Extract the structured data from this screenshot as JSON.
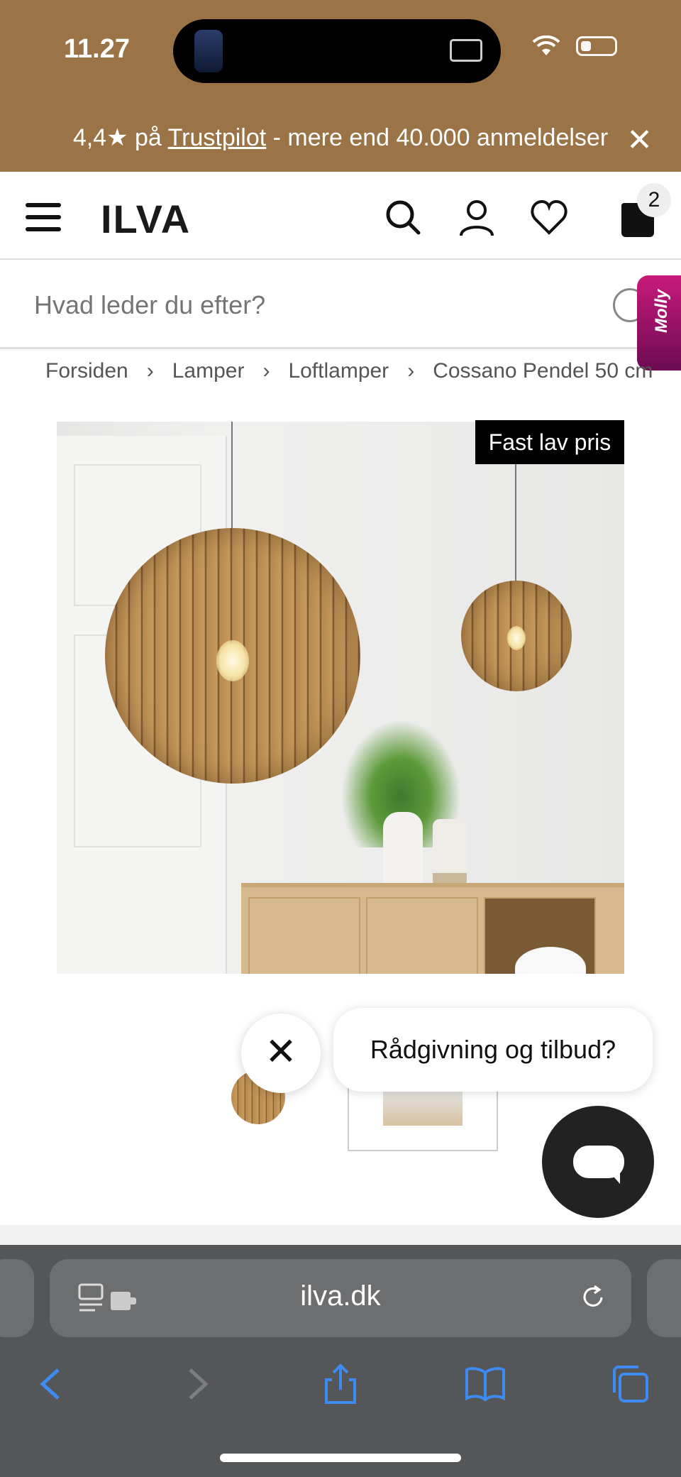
{
  "status_bar": {
    "time": "11.27"
  },
  "trust_banner": {
    "prefix": "4,4★ på ",
    "link": "Trustpilot",
    "suffix": " - mere end 40.000 anmeldelser",
    "close_glyph": "✕"
  },
  "header": {
    "logo": "ILVA",
    "cart_count": "2",
    "icons": [
      "menu-icon",
      "search-icon",
      "account-icon",
      "heart-icon",
      "bag-icon"
    ]
  },
  "search": {
    "placeholder": "Hvad leder du efter?"
  },
  "molly": {
    "label": "Molly"
  },
  "breadcrumb": {
    "items": [
      "Forsiden",
      "Lamper",
      "Loftlamper",
      "Cossano Pendel 50 cm"
    ],
    "separator": "›"
  },
  "product": {
    "badge": "Fast lav pris"
  },
  "chat": {
    "prompt": "Rådgivning og tilbud?",
    "close_glyph": "✕"
  },
  "browser": {
    "url": "ilva.dk"
  },
  "colors": {
    "banner": "#9a7446",
    "molly_accent": "#c91a7a",
    "safari_link": "#3d8bf2"
  }
}
